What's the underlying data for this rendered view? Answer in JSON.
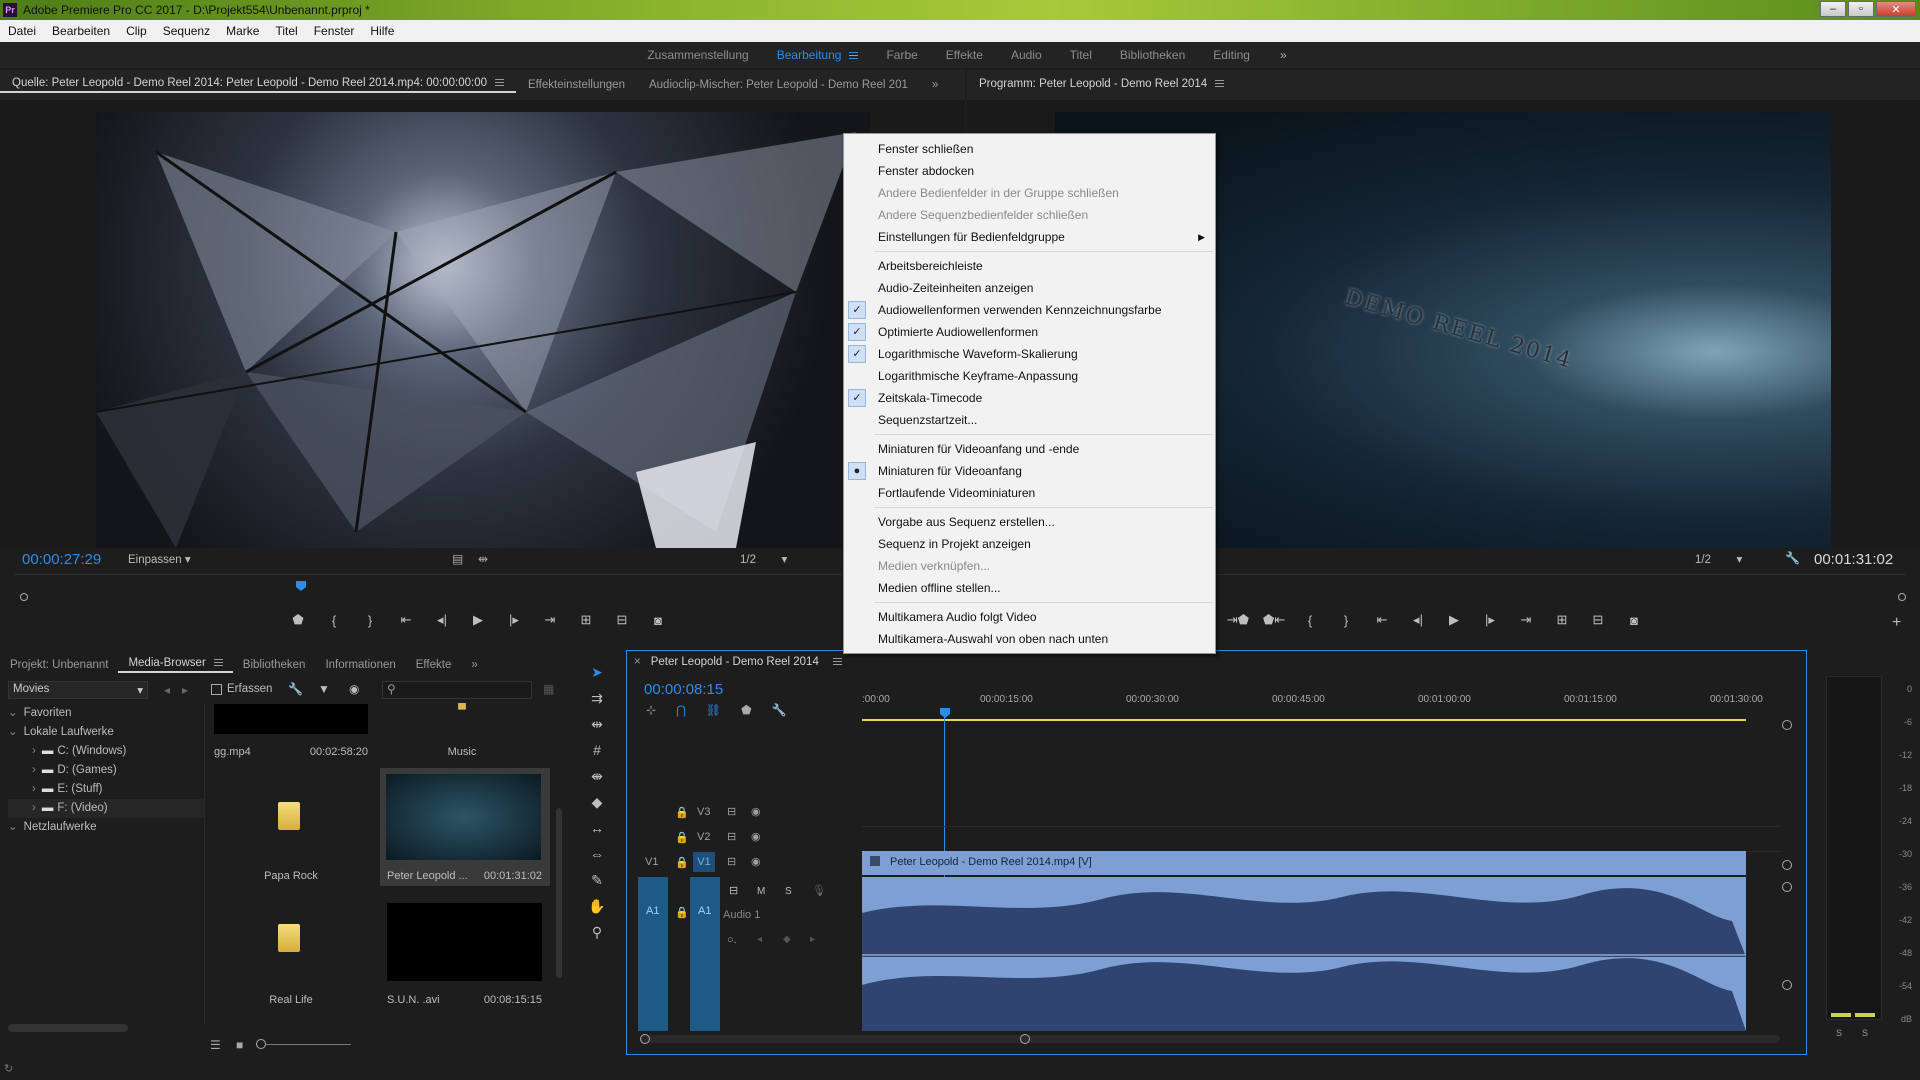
{
  "app": {
    "title": "Adobe Premiere Pro CC 2017 - D:\\Projekt554\\Unbenannt.prproj *",
    "logo": "Pr"
  },
  "window_buttons": {
    "minimize": "‒",
    "maximize": "▫",
    "close": "✕"
  },
  "menu": [
    "Datei",
    "Bearbeiten",
    "Clip",
    "Sequenz",
    "Marke",
    "Titel",
    "Fenster",
    "Hilfe"
  ],
  "workspaces": {
    "items": [
      "Zusammenstellung",
      "Bearbeitung",
      "Farbe",
      "Effekte",
      "Audio",
      "Titel",
      "Bibliotheken",
      "Editing"
    ],
    "active": "Bearbeitung",
    "more": "»"
  },
  "source_panel": {
    "tabs": [
      "Quelle: Peter Leopold - Demo Reel 2014: Peter Leopold - Demo Reel 2014.mp4: 00:00:00:00",
      "Effekteinstellungen",
      "Audioclip-Mischer: Peter Leopold - Demo Reel 201"
    ],
    "more": "»",
    "timecode": "00:00:27:29",
    "fit": "Einpassen",
    "resolution": "1/2"
  },
  "program_panel": {
    "tab": "Programm: Peter Leopold - Demo Reel 2014",
    "resolution": "1/2",
    "timecode": "00:01:31:02",
    "overlay_text": "DEMO REEL 2014"
  },
  "context_menu": [
    {
      "label": "Fenster schließen"
    },
    {
      "label": "Fenster abdocken"
    },
    {
      "label": "Andere Bedienfelder in der Gruppe schließen",
      "disabled": true
    },
    {
      "label": "Andere Sequenzbedienfelder schließen",
      "disabled": true
    },
    {
      "label": "Einstellungen für Bedienfeldgruppe",
      "submenu": true
    },
    {
      "sep": true
    },
    {
      "label": "Arbeitsbereichleiste"
    },
    {
      "label": "Audio-Zeiteinheiten anzeigen"
    },
    {
      "label": "Audiowellenformen verwenden Kennzeichnungsfarbe",
      "checked": true
    },
    {
      "label": "Optimierte Audiowellenformen",
      "checked": true
    },
    {
      "label": "Logarithmische Waveform-Skalierung",
      "checked": true
    },
    {
      "label": "Logarithmische Keyframe-Anpassung"
    },
    {
      "label": "Zeitskala-Timecode",
      "checked": true
    },
    {
      "label": "Sequenzstartzeit..."
    },
    {
      "sep": true
    },
    {
      "label": "Miniaturen für Videoanfang und -ende"
    },
    {
      "label": "Miniaturen für Videoanfang",
      "radio": true
    },
    {
      "label": "Fortlaufende Videominiaturen"
    },
    {
      "sep": true
    },
    {
      "label": "Vorgabe aus Sequenz erstellen..."
    },
    {
      "label": "Sequenz in Projekt anzeigen"
    },
    {
      "label": "Medien verknüpfen...",
      "disabled": true
    },
    {
      "label": "Medien offline stellen..."
    },
    {
      "sep": true
    },
    {
      "label": "Multikamera Audio folgt Video"
    },
    {
      "label": "Multikamera-Auswahl von oben nach unten"
    }
  ],
  "project_panel": {
    "tabs": [
      "Projekt: Unbenannt",
      "Media-Browser",
      "Bibliotheken",
      "Informationen",
      "Effekte"
    ],
    "active": "Media-Browser",
    "more": "»",
    "filter": "Movies",
    "ingest": "Erfassen",
    "tree": [
      {
        "label": "Favoriten",
        "level": 0
      },
      {
        "label": "Lokale Laufwerke",
        "level": 0
      },
      {
        "label": "C: (Windows)",
        "level": 1
      },
      {
        "label": "D: (Games)",
        "level": 1
      },
      {
        "label": "E: (Stuff)",
        "level": 1
      },
      {
        "label": "F: (Video)",
        "level": 1
      },
      {
        "label": "Netzlaufwerke",
        "level": 0
      }
    ],
    "items": [
      {
        "name": "gg.mp4",
        "duration": "00:02:58:20"
      },
      {
        "name": "Music",
        "duration": ""
      },
      {
        "name": "Papa Rock",
        "duration": ""
      },
      {
        "name": "Peter Leopold ...",
        "duration": "00:01:31:02"
      },
      {
        "name": "Real Life",
        "duration": ""
      },
      {
        "name": "S.U.N. .avi",
        "duration": "00:08:15:15"
      }
    ]
  },
  "timeline": {
    "tab": "Peter Leopold - Demo Reel 2014",
    "timecode": "00:00:08:15",
    "ruler": [
      ":00:00",
      "00:00:15:00",
      "00:00:30:00",
      "00:00:45:00",
      "00:01:00:00",
      "00:01:15:00",
      "00:01:30:00"
    ],
    "tracks": {
      "v3": "V3",
      "v2": "V2",
      "v1": "V1",
      "a1": "A1",
      "audio_name": "Audio 1",
      "m": "M",
      "s": "S"
    },
    "clip_label": "Peter Leopold - Demo Reel 2014.mp4 [V]"
  },
  "audio_meter": {
    "levels": [
      "0",
      "-6",
      "-12",
      "-18",
      "-24",
      "-30",
      "-36",
      "-42",
      "-48",
      "-54",
      "dB"
    ],
    "solo": [
      "S",
      "S"
    ]
  },
  "colors": {
    "accent": "#2d8ceb",
    "clip": "#7e9fd3",
    "menu_bg": "#f2f2f2"
  }
}
